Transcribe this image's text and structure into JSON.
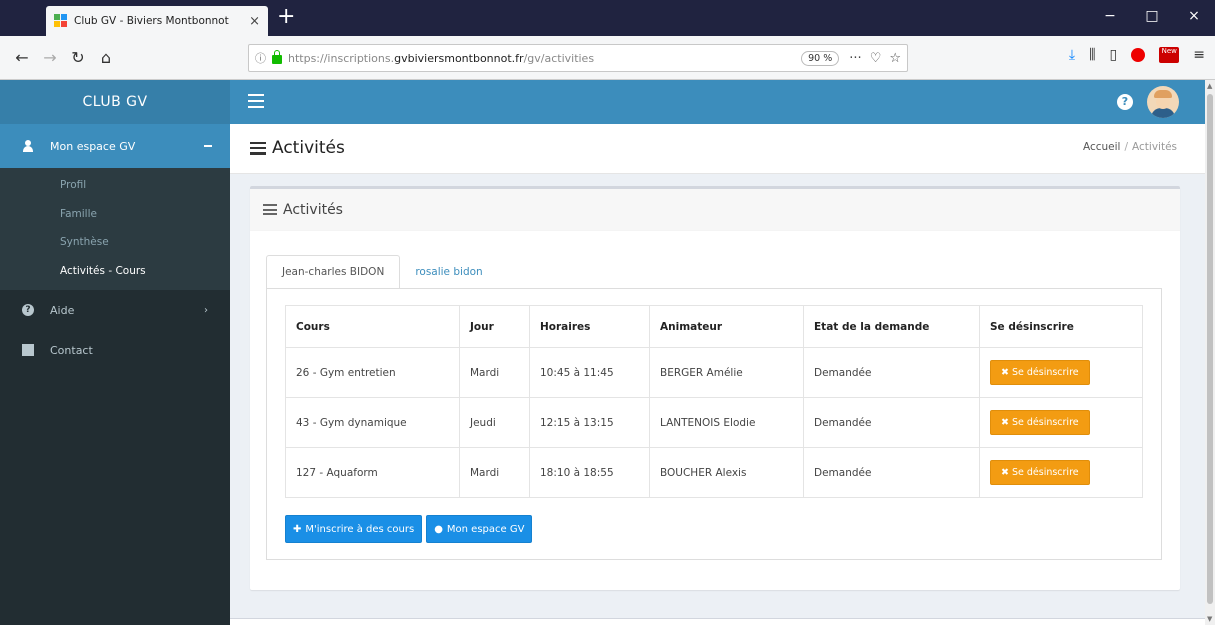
{
  "browser": {
    "tab_title": "Club GV - Biviers Montbonnot",
    "tab_close": "×",
    "new_tab": "+",
    "url_prefix": "https://inscriptions.",
    "url_domain": "gvbiviersmontbonnot.fr",
    "url_path": "/gv/activities",
    "zoom": "90 %",
    "url_more": "···",
    "win_min": "−",
    "win_max": "□",
    "win_close": "×"
  },
  "app": {
    "brand": "CLUB GV",
    "help": "?"
  },
  "sidebar": {
    "main": "Mon espace GV",
    "sub_items": [
      {
        "label": "Profil"
      },
      {
        "label": "Famille"
      },
      {
        "label": "Synthèse"
      },
      {
        "label": "Activités - Cours"
      }
    ],
    "items": [
      {
        "label": "Aide"
      },
      {
        "label": "Contact"
      }
    ]
  },
  "page": {
    "title": "Activités",
    "breadcrumb_home": "Accueil",
    "breadcrumb_sep": "/",
    "breadcrumb_current": "Activités"
  },
  "box": {
    "title": "Activités",
    "tabs": [
      {
        "label": "Jean-charles BIDON"
      },
      {
        "label": "rosalie bidon"
      }
    ]
  },
  "table": {
    "headers": [
      "Cours",
      "Jour",
      "Horaires",
      "Animateur",
      "Etat de la demande",
      "Se désinscrire"
    ],
    "rows": [
      {
        "cours": "26 - Gym entretien",
        "jour": "Mardi",
        "horaires": "10:45 à 11:45",
        "animateur": "BERGER Amélie",
        "etat": "Demandée",
        "action": "Se désinscrire"
      },
      {
        "cours": "43 - Gym dynamique",
        "jour": "Jeudi",
        "horaires": "12:15 à 13:15",
        "animateur": "LANTENOIS Elodie",
        "etat": "Demandée",
        "action": "Se désinscrire"
      },
      {
        "cours": "127 - Aquaform",
        "jour": "Mardi",
        "horaires": "18:10 à 18:55",
        "animateur": "BOUCHER Alexis",
        "etat": "Demandée",
        "action": "Se désinscrire"
      }
    ]
  },
  "buttons": {
    "subscribe": "M'inscrire à des cours",
    "my_space": "Mon espace GV"
  },
  "colors": {
    "header": "#3c8dbc",
    "sidebar": "#222d32",
    "warning": "#f39c12",
    "primary": "#1a8fe6"
  }
}
